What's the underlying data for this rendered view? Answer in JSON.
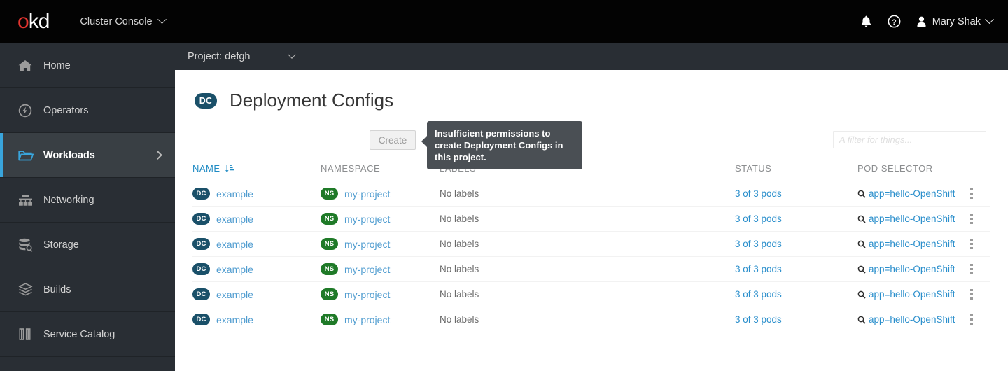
{
  "masthead": {
    "logo_o": "o",
    "logo_kd": "kd",
    "console_label": "Cluster Console",
    "notifications_icon": "bell-icon",
    "help_icon": "question-circle-icon",
    "avatar_icon": "user-avatar-icon",
    "user_name": "Mary Shak"
  },
  "projectbar": {
    "project_label": "Project: defgh"
  },
  "sidebar": {
    "items": [
      {
        "label": "Home",
        "icon": "home-icon",
        "active": false
      },
      {
        "label": "Operators",
        "icon": "operators-icon",
        "active": false
      },
      {
        "label": "Workloads",
        "icon": "folder-icon",
        "active": true
      },
      {
        "label": "Networking",
        "icon": "network-icon",
        "active": false
      },
      {
        "label": "Storage",
        "icon": "storage-icon",
        "active": false
      },
      {
        "label": "Builds",
        "icon": "builds-icon",
        "active": false
      },
      {
        "label": "Service Catalog",
        "icon": "book-icon",
        "active": false
      }
    ]
  },
  "page": {
    "badge": "DC",
    "title": "Deployment Configs"
  },
  "toolbar": {
    "create_label": "Create",
    "create_disabled": true,
    "tooltip_text": "Insufficient permissions to create Deployment Configs in this project.",
    "filter_placeholder": "A filter for things...",
    "filter_value": ""
  },
  "table": {
    "columns": [
      {
        "label": "NAME",
        "sorted": true,
        "sort_icon": "sort-amount-down-icon"
      },
      {
        "label": "NAMESPACE",
        "sorted": false,
        "sort_icon": ""
      },
      {
        "label": "LABELS",
        "sorted": false,
        "sort_icon": ""
      },
      {
        "label": "STATUS",
        "sorted": false,
        "sort_icon": ""
      },
      {
        "label": "POD SELECTOR",
        "sorted": false,
        "sort_icon": ""
      }
    ],
    "rows": [
      {
        "name_badge": "DC",
        "name": "example",
        "ns_badge": "NS",
        "namespace": "my-project",
        "labels": "No labels",
        "status": "3 of 3 pods",
        "selector": "app=hello-OpenShift",
        "actions_icon": "kebab-menu-icon"
      },
      {
        "name_badge": "DC",
        "name": "example",
        "ns_badge": "NS",
        "namespace": "my-project",
        "labels": "No labels",
        "status": "3 of 3 pods",
        "selector": "app=hello-OpenShift",
        "actions_icon": "kebab-menu-icon"
      },
      {
        "name_badge": "DC",
        "name": "example",
        "ns_badge": "NS",
        "namespace": "my-project",
        "labels": "No labels",
        "status": "3 of 3 pods",
        "selector": "app=hello-OpenShift",
        "actions_icon": "kebab-menu-icon"
      },
      {
        "name_badge": "DC",
        "name": "example",
        "ns_badge": "NS",
        "namespace": "my-project",
        "labels": "No labels",
        "status": "3 of 3 pods",
        "selector": "app=hello-OpenShift",
        "actions_icon": "kebab-menu-icon"
      },
      {
        "name_badge": "DC",
        "name": "example",
        "ns_badge": "NS",
        "namespace": "my-project",
        "labels": "No labels",
        "status": "3 of 3 pods",
        "selector": "app=hello-OpenShift",
        "actions_icon": "kebab-menu-icon"
      },
      {
        "name_badge": "DC",
        "name": "example",
        "ns_badge": "NS",
        "namespace": "my-project",
        "labels": "No labels",
        "status": "3 of 3 pods",
        "selector": "app=hello-OpenShift",
        "actions_icon": "kebab-menu-icon"
      }
    ]
  },
  "colors": {
    "masthead_bg": "#030303",
    "sidebar_bg": "#292e34",
    "sidebar_active_bg": "#393f44",
    "accent_blue": "#39a5dc",
    "link_blue": "#519dd0",
    "badge_dc": "#1a5069",
    "badge_ns": "#1f7a28",
    "logo_red": "#e3342f",
    "tooltip_bg": "#4a4f54"
  }
}
